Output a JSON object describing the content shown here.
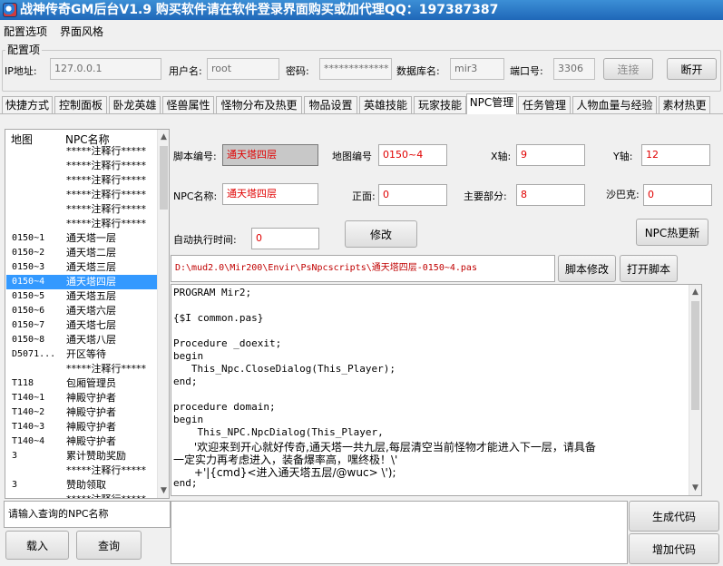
{
  "window": {
    "title": "战神传奇GM后台V1.9  购买软件请在软件登录界面购买或加代理QQ：197387387"
  },
  "menu": {
    "items": [
      "配置选项",
      "界面风格"
    ]
  },
  "config": {
    "group_label": "配置项",
    "ip_label": "IP地址:",
    "ip_value": "127.0.0.1",
    "user_label": "用户名:",
    "user_value": "root",
    "password_label": "密码:",
    "password_value": "*************",
    "db_label": "数据库名:",
    "db_value": "mir3",
    "port_label": "端口号:",
    "port_value": "3306",
    "connect_label": "连接",
    "disconnect_label": "断开"
  },
  "tabs": [
    "快捷方式",
    "控制面板",
    "卧龙英雄",
    "怪兽属性",
    "怪物分布及热更",
    "物品设置",
    "英雄技能",
    "玩家技能",
    "NPC管理",
    "任务管理",
    "人物血量与经验",
    "素材热更"
  ],
  "active_tab": "NPC管理",
  "npc_list": {
    "headers": [
      "地图",
      "NPC名称"
    ],
    "rows": [
      {
        "map": "",
        "name": "*****注释行*****"
      },
      {
        "map": "",
        "name": "*****注释行*****"
      },
      {
        "map": "",
        "name": "*****注释行*****"
      },
      {
        "map": "",
        "name": "*****注释行*****"
      },
      {
        "map": "",
        "name": "*****注释行*****"
      },
      {
        "map": "",
        "name": "*****注释行*****"
      },
      {
        "map": "0150~1",
        "name": "通天塔一层"
      },
      {
        "map": "0150~2",
        "name": "通天塔二层"
      },
      {
        "map": "0150~3",
        "name": "通天塔三层"
      },
      {
        "map": "0150~4",
        "name": "通天塔四层"
      },
      {
        "map": "0150~5",
        "name": "通天塔五层"
      },
      {
        "map": "0150~6",
        "name": "通天塔六层"
      },
      {
        "map": "0150~7",
        "name": "通天塔七层"
      },
      {
        "map": "0150~8",
        "name": "通天塔八层"
      },
      {
        "map": "D5071...",
        "name": "开区等待"
      },
      {
        "map": "",
        "name": "*****注释行*****"
      },
      {
        "map": "T118",
        "name": "包厢管理员"
      },
      {
        "map": "T140~1",
        "name": "神殿守护者"
      },
      {
        "map": "T140~2",
        "name": "神殿守护者"
      },
      {
        "map": "T140~3",
        "name": "神殿守护者"
      },
      {
        "map": "T140~4",
        "name": "神殿守护者"
      },
      {
        "map": "3",
        "name": "累计赞助奖励"
      },
      {
        "map": "",
        "name": "*****注释行*****"
      },
      {
        "map": "3",
        "name": "赞助领取"
      },
      {
        "map": "",
        "name": "*****注释行*****"
      }
    ]
  },
  "npc_form": {
    "script_no_label": "脚本编号:",
    "script_no_value": "通天塔四层",
    "map_no_label": "地图编号",
    "map_no_value": "0150~4",
    "x_label": "X轴:",
    "x_value": "9",
    "y_label": "Y轴:",
    "y_value": "12",
    "npc_name_label": "NPC名称:",
    "npc_name_value": "通天塔四层",
    "face_label": "正面:",
    "face_value": "0",
    "main_part_label": "主要部分:",
    "main_part_value": "8",
    "sabac_label": "沙巴克:",
    "sabac_value": "0",
    "auto_time_label": "自动执行时间:",
    "auto_time_value": "0",
    "modify_label": "修改",
    "npc_hot_update_label": "NPC热更新",
    "script_path": "D:\\mud2.0\\Mir200\\Envir\\PsNpcscripts\\通天塔四层-0150~4.pas",
    "script_edit_label": "脚本修改",
    "open_script_label": "打开脚本"
  },
  "code_lines": [
    "PROGRAM Mir2;",
    "",
    "{$I common.pas}",
    "",
    "Procedure _doexit;",
    "begin",
    "   This_Npc.CloseDialog(This_Player);",
    "end;",
    "",
    "procedure domain;",
    "begin",
    "    This_NPC.NpcDialog(This_Player,",
    "      '欢迎来到开心就好传奇,通天塔一共九层,每层清空当前怪物才能进入下一层，请具备",
    "一定实力再考虑进入，装备爆率高，嘿终极！\\'",
    "      +'|{cmd}<进入通天塔五层/@wuc> \\');",
    "end;"
  ],
  "bottom": {
    "search_value": "请输入查询的NPC名称",
    "load_label": "载入",
    "query_label": "查询",
    "generate_label": "生成代码",
    "add_label": "增加代码"
  }
}
